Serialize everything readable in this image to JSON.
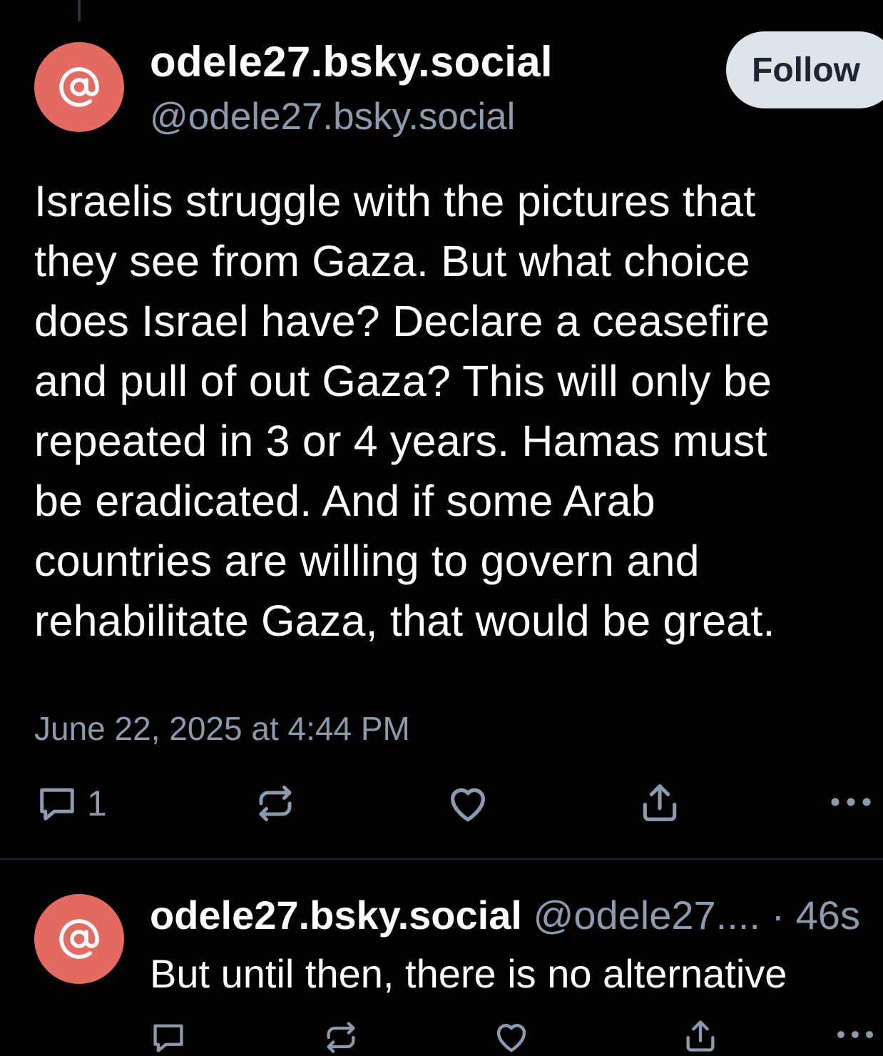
{
  "post": {
    "display_name": "odele27.bsky.social",
    "handle": "@odele27.bsky.social",
    "follow_label": "Follow",
    "text": "Israelis struggle with the pictures that\nthey see from Gaza. But what choice\ndoes Israel have? Declare a ceasefire\nand pull of out Gaza? This will only be\nrepeated in 3 or 4 years. Hamas must\nbe eradicated. And if some Arab\ncountries are willing to govern and\nrehabilitate Gaza, that would be great.",
    "timestamp": "June 22, 2025 at 4:44 PM",
    "reply_count": "1"
  },
  "reply": {
    "display_name": "odele27.bsky.social",
    "handle": "@odele27....",
    "separator": "·",
    "time": "46s",
    "text": "But until then, there is no alternative"
  },
  "icons": {
    "avatar": "at-sign-icon",
    "reply": "speech-bubble-icon",
    "repost": "repost-icon",
    "like": "heart-icon",
    "share": "share-icon",
    "more": "more-dots-icon"
  },
  "colors": {
    "background": "#000000",
    "avatar": "#e56b62",
    "muted_text": "#8d9aab",
    "follow_button_bg": "#dfe4ea",
    "icon": "#8d9aab"
  }
}
